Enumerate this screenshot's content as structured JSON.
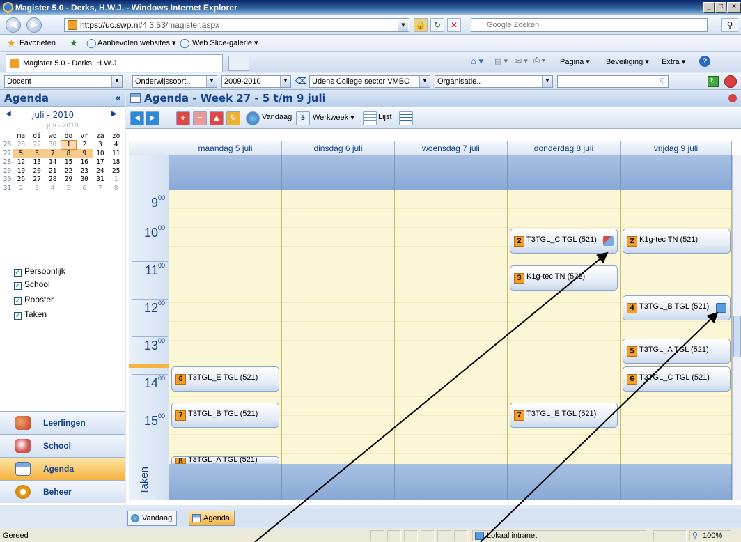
{
  "window": {
    "title": "Magister 5.0 - Derks, H.W.J. - Windows Internet Explorer",
    "min": "_",
    "max": "□",
    "close": "×"
  },
  "addressbar": {
    "url_lead": "https://uc.swp.nl",
    "url_rest": "/4.3.53/magister.aspx",
    "search_placeholder": "Google Zoeken"
  },
  "favorites": {
    "label": "Favorieten",
    "item1": "Aanbevolen websites ▾",
    "item2": "Web Slice-galerie ▾"
  },
  "tabbar": {
    "tab_title": "Magister 5.0 - Derks, H.W.J.",
    "pagina": "Pagina ▾",
    "beveiliging": "Beveiliging ▾",
    "extra": "Extra ▾"
  },
  "toolbar": {
    "role": "Docent",
    "onderwijssoort": "Onderwijssoort..",
    "schooljaar": "2009-2010",
    "school": "Udens College sector VMBO",
    "organisatie": "Organisatie.."
  },
  "left": {
    "header": "Agenda",
    "collapse": "«",
    "month": "juli - 2010",
    "month_sub": "juli - 2010",
    "weekday_headers": [
      "ma",
      "di",
      "wo",
      "do",
      "vr",
      "za",
      "zo"
    ],
    "weeks": [
      {
        "wk": "26",
        "days": [
          "28",
          "29",
          "30",
          "1",
          "2",
          "3",
          "4"
        ]
      },
      {
        "wk": "27",
        "days": [
          "5",
          "6",
          "7",
          "8",
          "9",
          "10",
          "11"
        ]
      },
      {
        "wk": "28",
        "days": [
          "12",
          "13",
          "14",
          "15",
          "16",
          "17",
          "18"
        ]
      },
      {
        "wk": "29",
        "days": [
          "19",
          "20",
          "21",
          "22",
          "23",
          "24",
          "25"
        ]
      },
      {
        "wk": "30",
        "days": [
          "26",
          "27",
          "28",
          "29",
          "30",
          "31",
          "1"
        ]
      },
      {
        "wk": "31",
        "days": [
          "2",
          "3",
          "4",
          "5",
          "6",
          "7",
          "8"
        ]
      }
    ],
    "checkboxes": [
      "Persoonlijk",
      "School",
      "Rooster",
      "Taken"
    ],
    "nav": [
      "Leerlingen",
      "School",
      "Agenda",
      "Beheer"
    ]
  },
  "main": {
    "title": "Agenda - Week 27 - 5 t/m 9 juli",
    "vandaag": "Vandaag",
    "werkweek": "Werkweek ▾",
    "lijst": "Lijst",
    "days": [
      "maandag 5 juli",
      "dinsdag 6 juli",
      "woensdag 7 juli",
      "donderdag 8 juli",
      "vrijdag 9 juli"
    ],
    "hours": [
      "9",
      "10",
      "11",
      "12",
      "13",
      "14",
      "15"
    ],
    "hour_suffix": "00",
    "taken_label": "Taken",
    "appointments": [
      {
        "num": "2",
        "text": "T3TGL_C TGL (521)"
      },
      {
        "num": "2",
        "text": "K1g-tec TN (521)"
      },
      {
        "num": "3",
        "text": "K1g-tec TN (522)"
      },
      {
        "num": "4",
        "text": "T3TGL_B TGL (521)"
      },
      {
        "num": "5",
        "text": "T3TGL_A TGL (521)"
      },
      {
        "num": "6",
        "text": "T3TGL_E TGL (521)"
      },
      {
        "num": "6",
        "text": "T3TGL_C TGL (521)"
      },
      {
        "num": "7",
        "text": "T3TGL_B TGL (521)"
      },
      {
        "num": "7",
        "text": "T3TGL_E TGL (521)"
      },
      {
        "num": "8",
        "text": "T3TGL_A TGL (521)"
      }
    ],
    "bottom_tabs": [
      "Vandaag",
      "Agenda"
    ]
  },
  "statusbar": {
    "left": "Gereed",
    "zone": "Lokaal intranet",
    "zoom": "100%"
  },
  "colors": {
    "accent": "#15428b",
    "orange": "#f29f27",
    "calendar_bg": "#fbf7d6",
    "band_blue": "#88a8d6"
  }
}
